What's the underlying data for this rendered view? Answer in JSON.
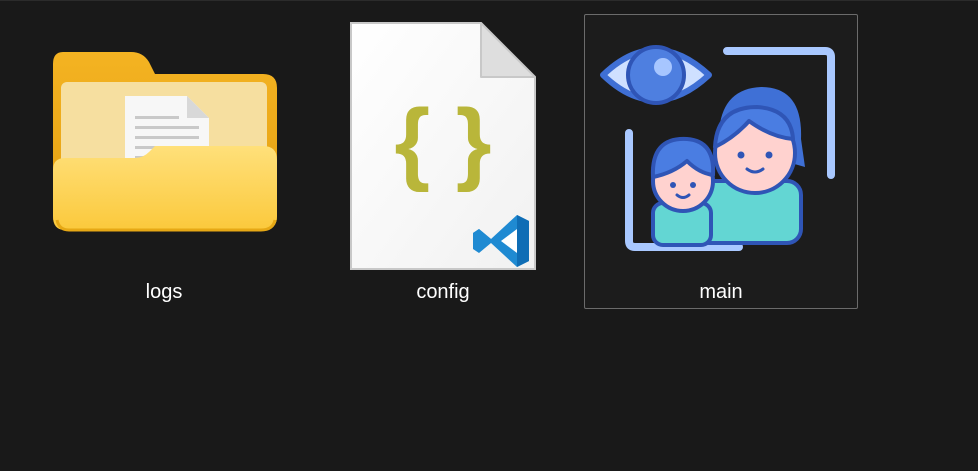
{
  "files": [
    {
      "name": "logs",
      "kind": "folder",
      "icon": "folder-icon",
      "selected": false
    },
    {
      "name": "config",
      "kind": "json",
      "icon": "json-file-icon",
      "selected": false
    },
    {
      "name": "main",
      "kind": "image",
      "icon": "family-eye-image-icon",
      "selected": true
    }
  ],
  "colors": {
    "background": "#191919",
    "selection_border": "#6b6b6b",
    "label_text": "#ffffff"
  }
}
